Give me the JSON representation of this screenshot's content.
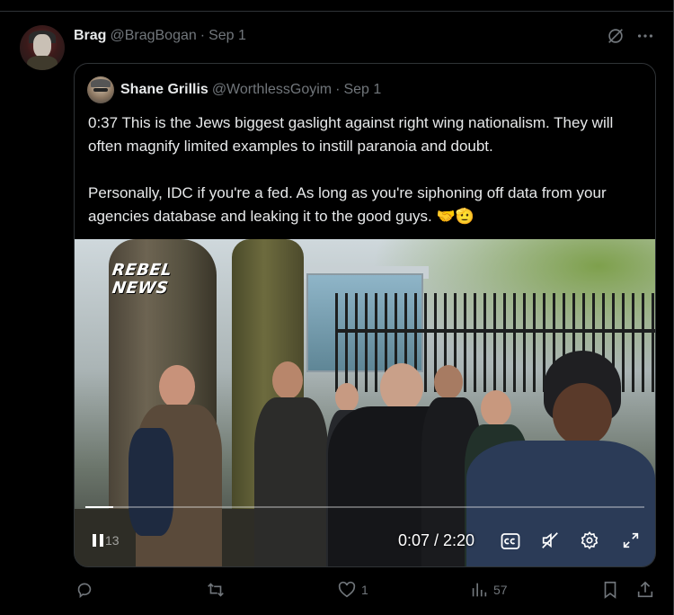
{
  "post": {
    "author_name": "Brag",
    "author_handle": "@BragBogan",
    "separator": "·",
    "date": "Sep 1",
    "avatar_icon": "user-avatar",
    "grok_icon": "grok-icon",
    "more_icon": "more-icon"
  },
  "quote": {
    "author_name": "Shane Grillis",
    "author_handle": "@WorthlessGoyim",
    "separator": "·",
    "date": "Sep 1",
    "paragraph1": "0:37 This is the Jews biggest gaslight against right wing nationalism. They will often magnify limited examples to instill paranoia and doubt.",
    "paragraph2": "Personally, IDC if you're a fed. As long as you're siphoning off data from your agencies database and leaking it to the good guys. 🤝🫡"
  },
  "video": {
    "logo_line1": "REBEL",
    "logo_line2": "NEWS",
    "views_ghost": "13",
    "timecode": "0:07 / 2:20",
    "progress_fraction": 0.05,
    "controls": [
      "pause-icon",
      "closed-captions-icon",
      "mute-icon",
      "settings-icon",
      "fullscreen-icon"
    ]
  },
  "actions": {
    "reply_count": "",
    "repost_count": "",
    "like_count": "1",
    "views_count": "57"
  },
  "colors": {
    "background": "#000000",
    "text": "#e7e9ea",
    "muted": "#71767b",
    "border": "#2f3336"
  }
}
